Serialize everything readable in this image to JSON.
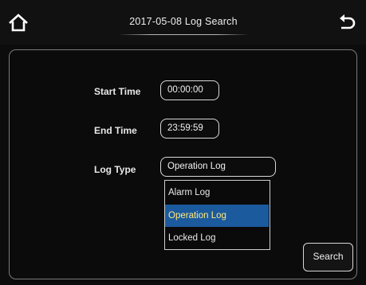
{
  "header": {
    "title": "2017-05-08  Log Search",
    "home_icon": "home-icon",
    "back_icon": "back-arrow-icon"
  },
  "form": {
    "start_time_label": "Start Time",
    "start_time_value": "00:00:00",
    "end_time_label": "End Time",
    "end_time_value": "23:59:59",
    "log_type_label": "Log Type",
    "log_type_value": "Operation Log"
  },
  "log_type_options": [
    {
      "label": "Alarm Log",
      "selected": false
    },
    {
      "label": "Operation Log",
      "selected": true
    },
    {
      "label": "Locked Log",
      "selected": false
    }
  ],
  "actions": {
    "search_label": "Search"
  },
  "colors": {
    "background": "#0c0c0c",
    "selected_item_bg": "#1c5a9e",
    "selected_item_text": "#ffe97a",
    "border": "#d8d8d8"
  }
}
